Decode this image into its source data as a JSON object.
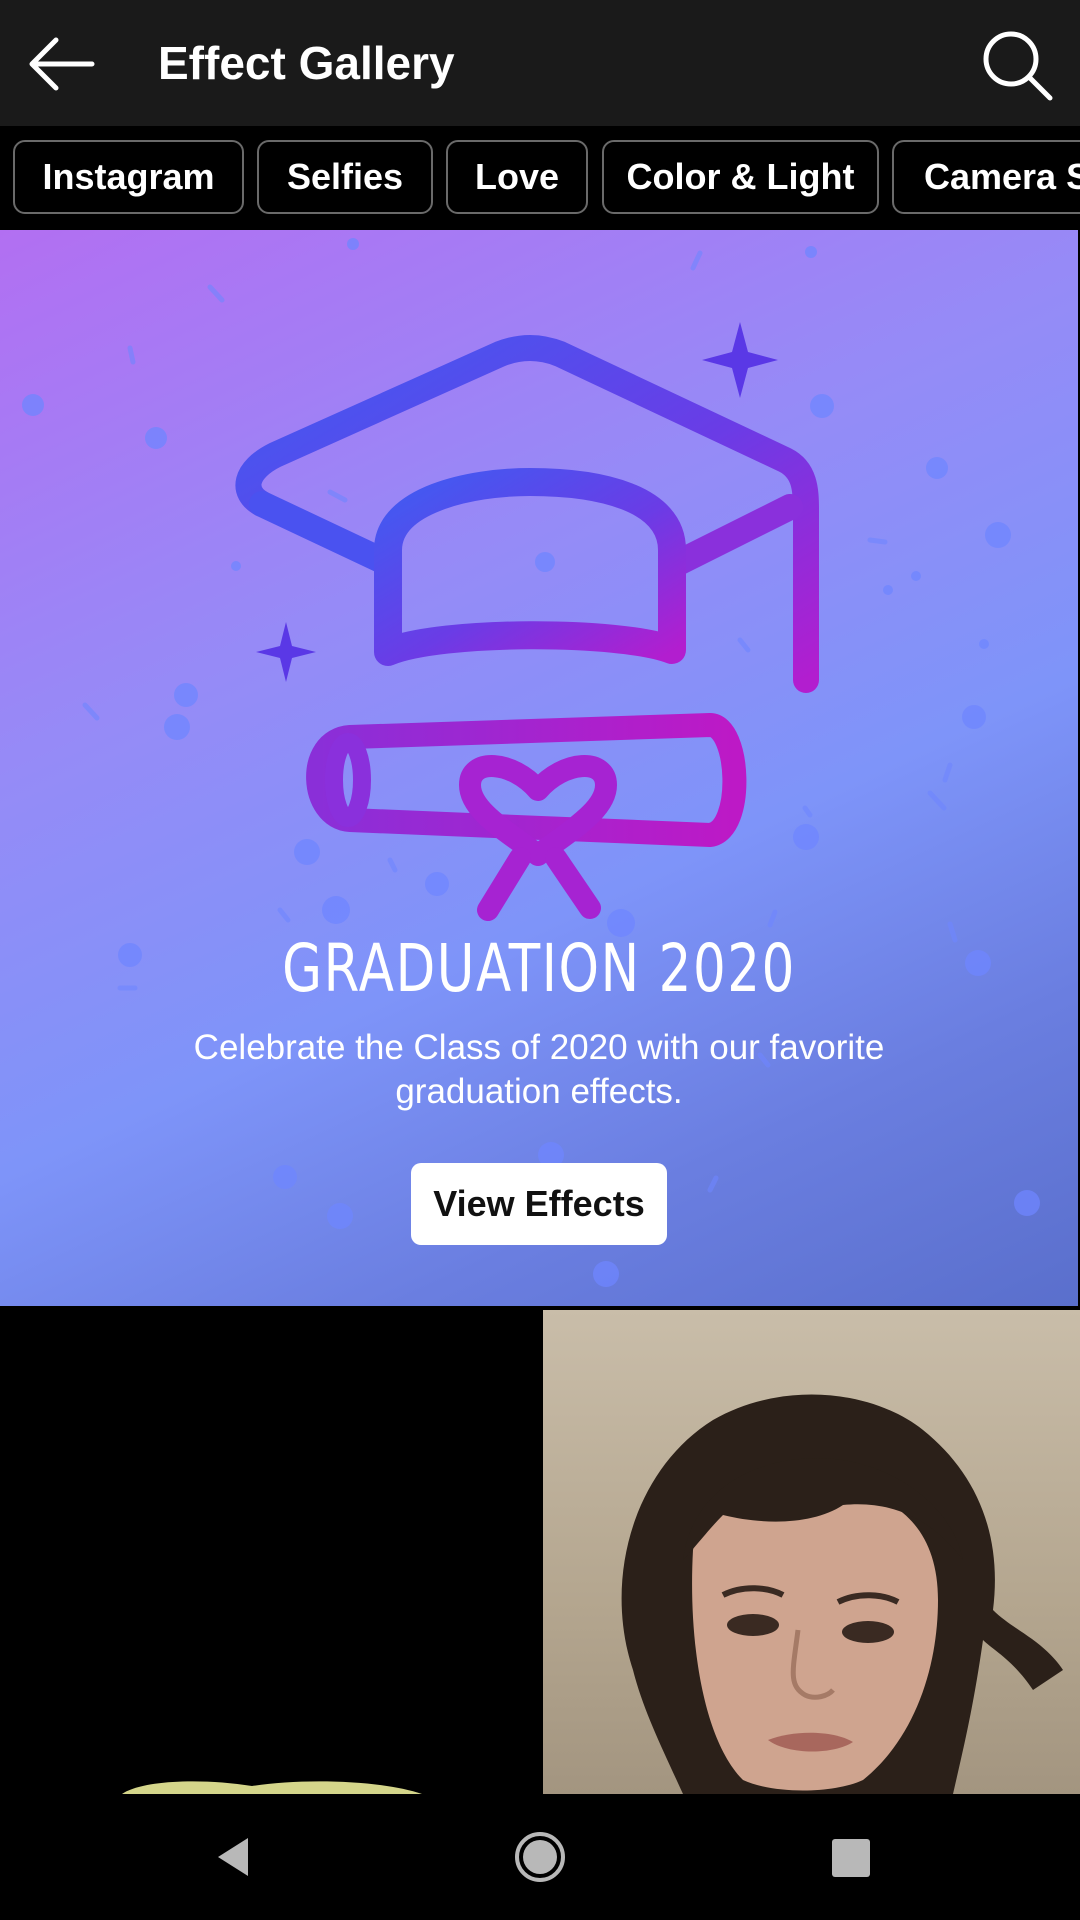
{
  "header": {
    "title": "Effect Gallery",
    "back_icon": "arrow-back-icon",
    "search_icon": "search-icon"
  },
  "categories": [
    "Instagram",
    "Selfies",
    "Love",
    "Color & Light",
    "Camera S"
  ],
  "banner": {
    "title": "GRADUATION 2020",
    "subtitle": "Celebrate the Class of 2020 with our favorite graduation effects.",
    "button_label": "View Effects",
    "art_icon": "graduation-cap-icon",
    "colors": {
      "gradient_start": "#b26ff2",
      "gradient_end": "#5a6fcc",
      "art_blue": "#4a52f0",
      "art_magenta": "#b21ecf"
    }
  },
  "thumbnails": [
    {
      "name": "effect-thumbnail-dark"
    },
    {
      "name": "effect-thumbnail-selfie"
    }
  ],
  "navbar": {
    "back_icon": "nav-back-icon",
    "home_icon": "nav-home-icon",
    "recents_icon": "nav-recents-icon"
  }
}
